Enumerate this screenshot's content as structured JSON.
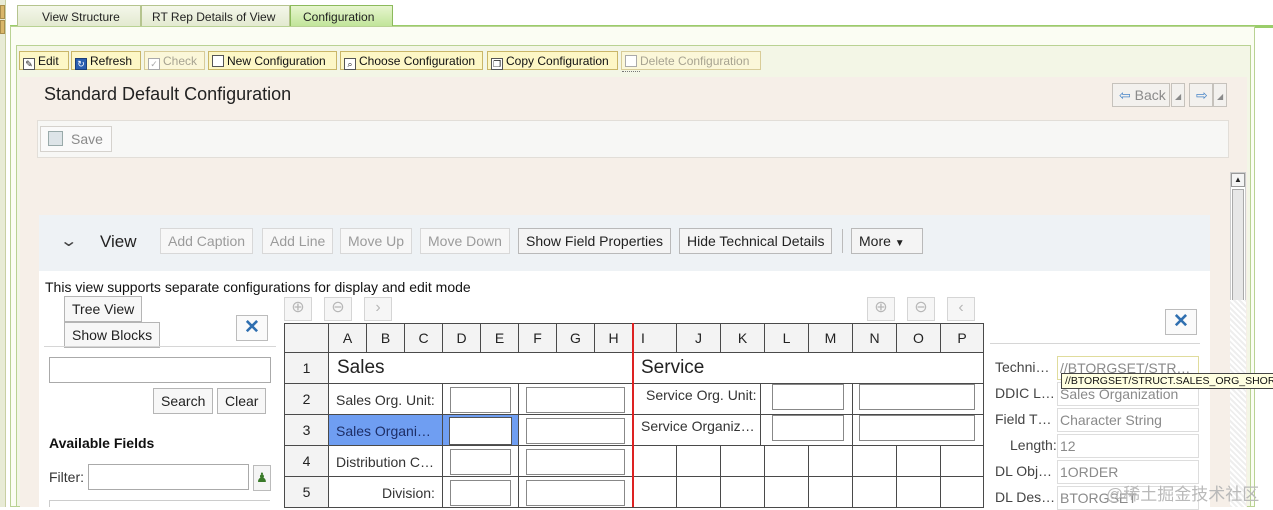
{
  "tabs": [
    "View Structure",
    "RT Rep Details of View",
    "Configuration"
  ],
  "toolbar": {
    "edit": "Edit",
    "refresh": "Refresh",
    "check": "Check",
    "new_configuration": "New Configuration",
    "choose_configuration": "Choose Configuration",
    "copy_configuration": "Copy Configuration",
    "delete_configuration": "Delete Configuration"
  },
  "page": {
    "title": "Standard Default Configuration",
    "back": "Back",
    "save": "Save"
  },
  "view": {
    "label": "View",
    "buttons": {
      "add_caption": "Add Caption",
      "add_line": "Add Line",
      "move_up": "Move Up",
      "move_down": "Move Down",
      "show_field_properties": "Show Field Properties",
      "hide_technical_details": "Hide Technical Details",
      "more": "More"
    },
    "info": "This view supports separate configurations for display and edit mode"
  },
  "left_panel": {
    "tree_view": "Tree View",
    "show_blocks": "Show Blocks",
    "search_value": "",
    "search": "Search",
    "clear": "Clear",
    "available_fields": "Available Fields",
    "filter_label": "Filter:",
    "filter_value": ""
  },
  "grid": {
    "columns": [
      "A",
      "B",
      "C",
      "D",
      "E",
      "F",
      "G",
      "H",
      "I",
      "J",
      "K",
      "L",
      "M",
      "N",
      "O",
      "P"
    ],
    "rows": [
      "1",
      "2",
      "3",
      "4",
      "5"
    ],
    "sales_title": "Sales",
    "service_title": "Service",
    "sales_fields": [
      "Sales Org. Unit:",
      "Sales Organi…",
      "Distribution C…",
      "Division:"
    ],
    "service_fields": [
      "Service Org. Unit:",
      "Service Organiz…"
    ]
  },
  "properties": {
    "labels": [
      "Techni…",
      "DDIC L…",
      "Field T…",
      "Length:",
      "DL Obj…",
      "DL Des…"
    ],
    "values": [
      "//BTORGSET/STR…",
      "Sales Organization",
      "Character String",
      "12",
      "1ORDER",
      "BTORGSET"
    ],
    "tooltip": "//BTORGSET/STRUCT.SALES_ORG_SHORT"
  },
  "watermark": "@稀土掘金技术社区",
  "colors": {
    "tab_active": "#bfe497",
    "toolbar_bg": "#fdf7c6",
    "selected_cell": "#6f9ef2",
    "split_line": "#dd2222",
    "close_icon": "#2f6fb0"
  }
}
